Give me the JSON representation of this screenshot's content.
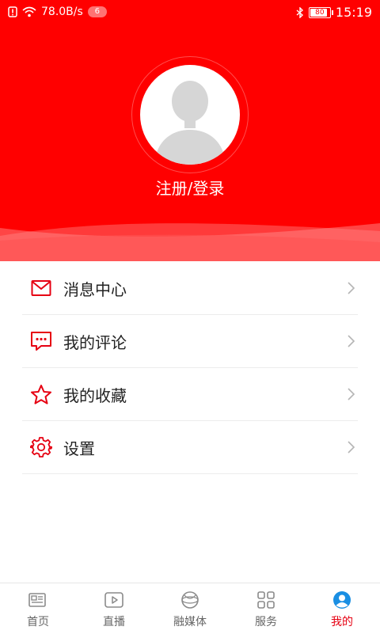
{
  "status_bar": {
    "speed": "78.0B/s",
    "notif_count": "6",
    "battery": "80",
    "time": "15:19"
  },
  "profile": {
    "login_label": "注册/登录"
  },
  "menu": {
    "items": [
      {
        "label": "消息中心",
        "icon": "mail-icon"
      },
      {
        "label": "我的评论",
        "icon": "comment-icon"
      },
      {
        "label": "我的收藏",
        "icon": "star-icon"
      },
      {
        "label": "设置",
        "icon": "gear-icon"
      }
    ]
  },
  "tabbar": {
    "tabs": [
      {
        "label": "首页",
        "icon": "news-icon"
      },
      {
        "label": "直播",
        "icon": "play-icon"
      },
      {
        "label": "融媒体",
        "icon": "globe-icon"
      },
      {
        "label": "服务",
        "icon": "grid-icon"
      },
      {
        "label": "我的",
        "icon": "user-icon",
        "active": true
      }
    ]
  },
  "colors": {
    "brand_red": "#ff0000",
    "accent_red": "#e60012",
    "text": "#222222",
    "tab_text": "#666666"
  }
}
